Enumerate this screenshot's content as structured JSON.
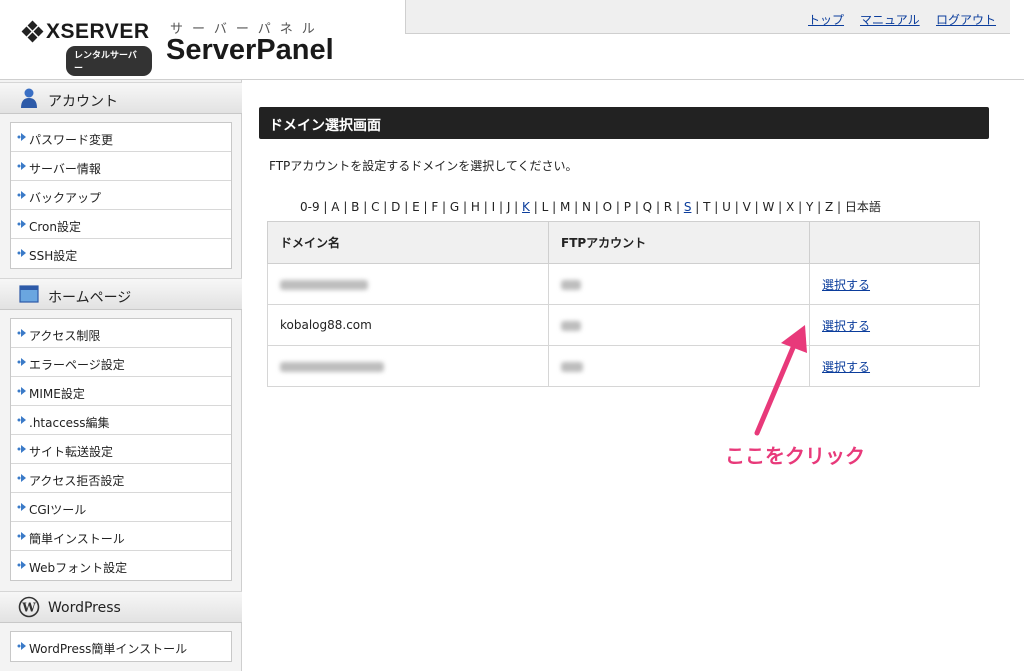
{
  "header": {
    "brand": "XSERVER",
    "brand_badge": "レンタルサーバー",
    "panel_kana": "サーバーパネル",
    "panel_title": "ServerPanel",
    "nav": [
      {
        "label": "トップ"
      },
      {
        "label": "マニュアル"
      },
      {
        "label": "ログアウト"
      }
    ]
  },
  "sidebar": {
    "sections": [
      {
        "title": "アカウント",
        "icon": "user-icon",
        "items": [
          "パスワード変更",
          "サーバー情報",
          "バックアップ",
          "Cron設定",
          "SSH設定"
        ]
      },
      {
        "title": "ホームページ",
        "icon": "window-icon",
        "items": [
          "アクセス制限",
          "エラーページ設定",
          "MIME設定",
          ".htaccess編集",
          "サイト転送設定",
          "アクセス拒否設定",
          "CGIツール",
          "簡単インストール",
          "Webフォント設定"
        ]
      },
      {
        "title": "WordPress",
        "icon": "wordpress-icon",
        "items": [
          "WordPress簡単インストール"
        ]
      }
    ]
  },
  "main": {
    "title": "ドメイン選択画面",
    "instruction": "FTPアカウントを設定するドメインを選択してください。",
    "alphabet": [
      "0-9",
      "A",
      "B",
      "C",
      "D",
      "E",
      "F",
      "G",
      "H",
      "I",
      "J",
      "K",
      "L",
      "M",
      "N",
      "O",
      "P",
      "Q",
      "R",
      "S",
      "T",
      "U",
      "V",
      "W",
      "X",
      "Y",
      "Z",
      "日本語"
    ],
    "alphabet_links": [
      "K",
      "S"
    ],
    "table": {
      "headers": [
        "ドメイン名",
        "FTPアカウント",
        ""
      ],
      "rows": [
        {
          "domain": "",
          "ftp": "",
          "action": "選択する"
        },
        {
          "domain": "kobalog88.com",
          "ftp": "",
          "action": "選択する"
        },
        {
          "domain": "",
          "ftp": "",
          "action": "選択する"
        }
      ]
    },
    "callout": "ここをクリック",
    "callout_color": "#e8397a"
  }
}
